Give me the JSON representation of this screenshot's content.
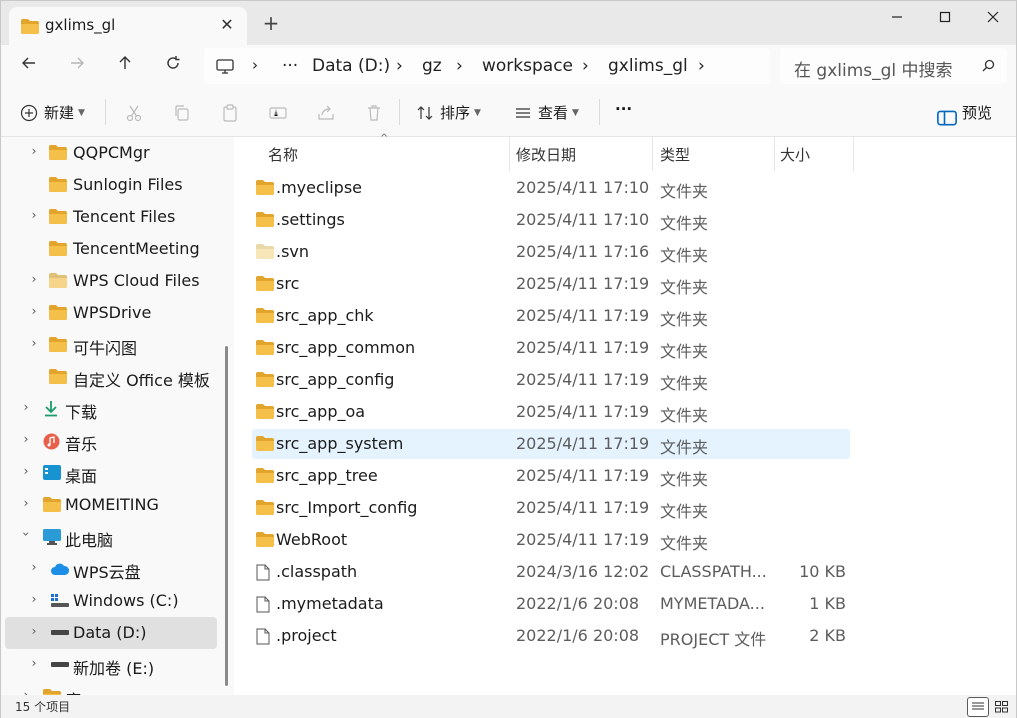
{
  "window": {
    "tab_title": "gxlims_gl",
    "tab_close": "✕",
    "new_tab": "+"
  },
  "address": {
    "ellipsis": "···",
    "crumbs": [
      "Data (D:)",
      "gz",
      "workspace",
      "gxlims_gl"
    ],
    "search_placeholder": "在 gxlims_gl 中搜索"
  },
  "toolbar": {
    "new_label": "新建",
    "sort_label": "排序",
    "view_label": "查看",
    "more_label": "···",
    "preview_label": "预览"
  },
  "sidebar": {
    "items": [
      {
        "label": "QQPCMgr"
      },
      {
        "label": "Sunlogin Files"
      },
      {
        "label": "Tencent Files"
      },
      {
        "label": "TencentMeeting"
      },
      {
        "label": "WPS Cloud Files"
      },
      {
        "label": "WPSDrive"
      },
      {
        "label": "可牛闪图"
      },
      {
        "label": "自定义 Office 模板"
      },
      {
        "label": "下载"
      },
      {
        "label": "音乐"
      },
      {
        "label": "桌面"
      },
      {
        "label": "MOMEITING"
      },
      {
        "label": "此电脑"
      },
      {
        "label": "WPS云盘"
      },
      {
        "label": "Windows (C:)"
      },
      {
        "label": "Data (D:)"
      },
      {
        "label": "新加卷 (E:)"
      },
      {
        "label": "库"
      }
    ]
  },
  "columns": {
    "name": "名称",
    "modified": "修改日期",
    "type": "类型",
    "size": "大小"
  },
  "files": [
    {
      "name": ".myeclipse",
      "date": "2025/4/11 17:10",
      "type": "文件夹",
      "size": ""
    },
    {
      "name": ".settings",
      "date": "2025/4/11 17:10",
      "type": "文件夹",
      "size": ""
    },
    {
      "name": ".svn",
      "date": "2025/4/11 17:16",
      "type": "文件夹",
      "size": ""
    },
    {
      "name": "src",
      "date": "2025/4/11 17:19",
      "type": "文件夹",
      "size": ""
    },
    {
      "name": "src_app_chk",
      "date": "2025/4/11 17:19",
      "type": "文件夹",
      "size": ""
    },
    {
      "name": "src_app_common",
      "date": "2025/4/11 17:19",
      "type": "文件夹",
      "size": ""
    },
    {
      "name": "src_app_config",
      "date": "2025/4/11 17:19",
      "type": "文件夹",
      "size": ""
    },
    {
      "name": "src_app_oa",
      "date": "2025/4/11 17:19",
      "type": "文件夹",
      "size": ""
    },
    {
      "name": "src_app_system",
      "date": "2025/4/11 17:19",
      "type": "文件夹",
      "size": ""
    },
    {
      "name": "src_app_tree",
      "date": "2025/4/11 17:19",
      "type": "文件夹",
      "size": ""
    },
    {
      "name": "src_Import_config",
      "date": "2025/4/11 17:19",
      "type": "文件夹",
      "size": ""
    },
    {
      "name": "WebRoot",
      "date": "2025/4/11 17:19",
      "type": "文件夹",
      "size": ""
    },
    {
      "name": ".classpath",
      "date": "2024/3/16 12:02",
      "type": "CLASSPATH...",
      "size": "10 KB"
    },
    {
      "name": ".mymetadata",
      "date": "2022/1/6 20:08",
      "type": "MYMETADA...",
      "size": "1 KB"
    },
    {
      "name": ".project",
      "date": "2022/1/6 20:08",
      "type": "PROJECT 文件",
      "size": "2 KB"
    }
  ],
  "status": {
    "item_count": "15 个项目"
  },
  "colors": {
    "folder": "#f4c04a",
    "folder_dark": "#e0a52a",
    "accent": "#0067c0",
    "selected_row": "#e5f3ff"
  }
}
